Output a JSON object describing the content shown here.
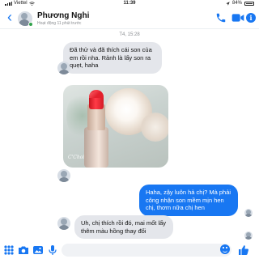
{
  "status_bar": {
    "carrier": "Viettel",
    "time": "11:39",
    "battery": "84%"
  },
  "header": {
    "contact_name": "Phương Nghi",
    "contact_status": "Hoạt động 11 phút trước",
    "icons": [
      "back-icon",
      "phone-icon",
      "video-icon",
      "info-icon"
    ]
  },
  "conversation": {
    "timestamp": "T4, 15:28",
    "messages": [
      {
        "sender": "contact",
        "text": "Đã thử và đã thích cái son của em rồi nha. Rảnh là lấy son ra quẹt, haha"
      },
      {
        "sender": "contact",
        "type": "photo",
        "watermark": "C'Choi"
      },
      {
        "sender": "me",
        "text": "Haha, zậy luôn hả chị? Mà phải công nhận son mềm mịn hen chị, thơm nữa chị hen"
      },
      {
        "sender": "contact",
        "text": "Uh, chị thích rồi đó, mai mốt lấy thêm màu hồng thay đổi"
      }
    ]
  },
  "composer": {
    "icons": [
      "apps-icon",
      "camera-icon",
      "gallery-icon",
      "mic-icon",
      "emoji-icon",
      "like-icon"
    ]
  },
  "colors": {
    "accent": "#1877f2",
    "incoming_bubble": "#e4e6eb",
    "online": "#31a24c"
  }
}
